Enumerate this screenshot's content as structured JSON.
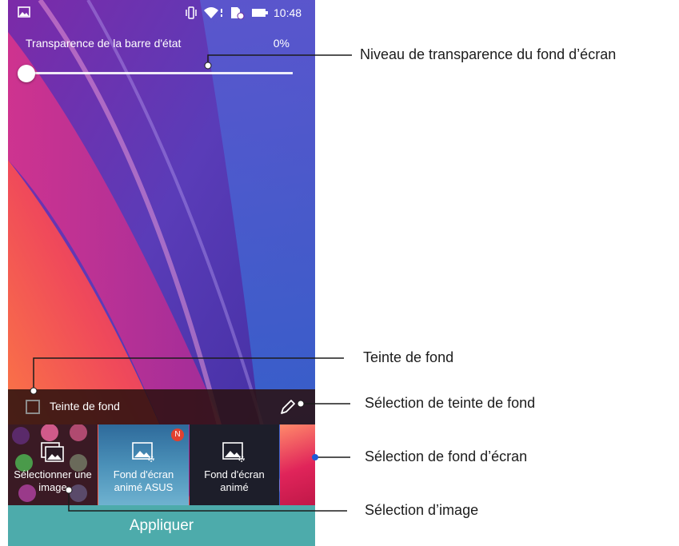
{
  "status_bar": {
    "time": "10:48"
  },
  "wallpaper_settings": {
    "transparency_label": "Transparence de la barre d'état",
    "transparency_value": "0%",
    "tint_label": "Teinte de fond"
  },
  "wallpaper_thumbnails": [
    {
      "label_line1": "Sélectionner une",
      "label_line2": "image"
    },
    {
      "label_line1": "Fond d'écran",
      "label_line2": "animé ASUS",
      "badge": "N"
    },
    {
      "label_line1": "Fond d'écran",
      "label_line2": "animé"
    }
  ],
  "apply_button": {
    "label": "Appliquer"
  },
  "callouts": {
    "transparency_level": "Niveau de transparence du fond d’écran",
    "background_tint": "Teinte de fond",
    "tint_selection": "Sélection de teinte de fond",
    "wallpaper_selection": "Sélection de fond d’écran",
    "image_selection": "Sélection d’image"
  },
  "colors": {
    "apply_button": "#4dabab",
    "tint_bar": "#2a100e",
    "badge": "#e2402e"
  }
}
